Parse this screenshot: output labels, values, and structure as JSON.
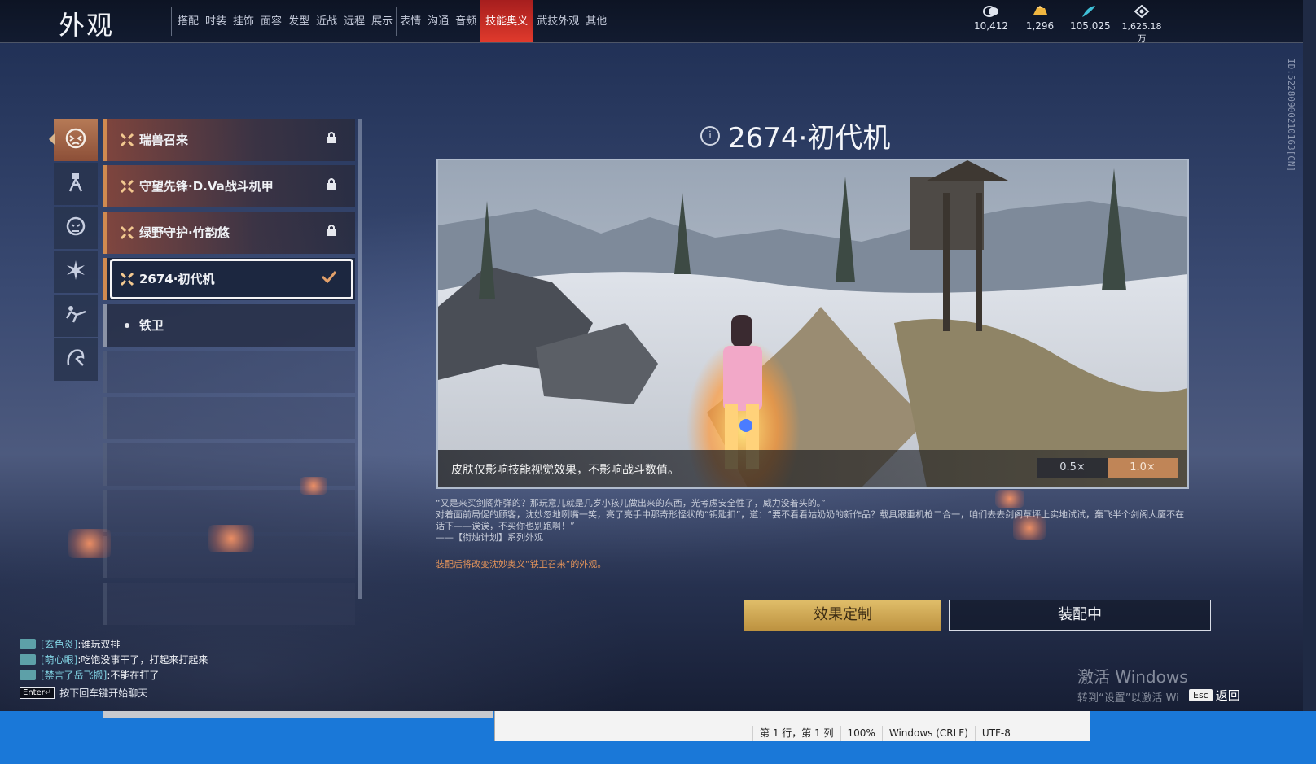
{
  "header": {
    "title": "外观",
    "tabs": [
      {
        "label": "搭配",
        "group": 1
      },
      {
        "label": "时装",
        "group": 1
      },
      {
        "label": "挂饰",
        "group": 1
      },
      {
        "label": "面容",
        "group": 1
      },
      {
        "label": "发型",
        "group": 1
      },
      {
        "label": "近战",
        "group": 1
      },
      {
        "label": "远程",
        "group": 1
      },
      {
        "label": "展示",
        "group": 1
      },
      {
        "label": "表情",
        "group": 2
      },
      {
        "label": "沟通",
        "group": 2
      },
      {
        "label": "音频",
        "group": 2
      },
      {
        "label": "技能奥义",
        "group": 2,
        "active": true
      },
      {
        "label": "武技外观",
        "group": 2
      },
      {
        "label": "其他",
        "group": 2
      }
    ],
    "currencies": [
      {
        "icon": "coin-icon",
        "value": "10,412"
      },
      {
        "icon": "gold-ingot-icon",
        "value": "1,296"
      },
      {
        "icon": "feather-icon",
        "value": "105,025"
      },
      {
        "icon": "diamond-icon",
        "value": "1,625.18万"
      }
    ]
  },
  "side_id": "ID:5228090021016​3[CN]",
  "categories": [
    {
      "icon": "beast-mask-icon",
      "active": true
    },
    {
      "icon": "robot-icon"
    },
    {
      "icon": "lion-mask-icon"
    },
    {
      "icon": "burst-icon"
    },
    {
      "icon": "flying-kick-icon"
    },
    {
      "icon": "dragon-icon"
    }
  ],
  "skins": [
    {
      "name": "瑞兽召来",
      "state": "locked"
    },
    {
      "name": "守望先锋·D.Va战斗机甲",
      "state": "locked"
    },
    {
      "name": "绿野守护·竹韵悠",
      "state": "locked"
    },
    {
      "name": "2674·初代机",
      "state": "equipped",
      "selected": true
    },
    {
      "name": "铁卫",
      "state": "default"
    }
  ],
  "empty_slots": 6,
  "detail": {
    "title": "2674·初代机",
    "caption": "皮肤仅影响技能视觉效果，不影响战斗数值。",
    "speeds": [
      {
        "label": "0.5×",
        "active": false
      },
      {
        "label": "1.0×",
        "active": true
      }
    ],
    "description": [
      "“又是来买剑阁炸弹的？那玩意儿就是几岁小孩儿做出来的东西，光考虑安全性了，威力没着头的。”",
      "对着面前局促的顾客，沈妙忽地咧嘴一笑，亮了亮手中那奇形怪状的“钥匙扣”，道：“要不看看姑奶奶的新作品？载具跟重机枪二合一，咱们去去剑阁草坪上实地试试，轰飞半个剑阁大厦不在话下——诶诶，不买你也别跑啊！”",
      "——【衔烛计划】系列外观"
    ],
    "note": "装配后将改变沈妙奥义“铁卫召来”的外观。"
  },
  "buttons": {
    "customize": "效果定制",
    "equipped": "装配中"
  },
  "chat": {
    "lines": [
      {
        "name": "[玄色炎]",
        "msg": ":谁玩双排"
      },
      {
        "name": "[萌心眼]",
        "msg": ":吃饱没事干了，打起来打起来"
      },
      {
        "name": "[禁言了岳飞搬]",
        "msg": ":不能在打了"
      }
    ],
    "enter_key": "Enter↵",
    "hint": "按下回车键开始聊天"
  },
  "watermark": {
    "title": "激活 Windows",
    "subtitle": "转到“设置”以激活 Wi"
  },
  "back": {
    "key": "Esc",
    "label": "返回"
  },
  "notepad_status": [
    "第 1 行，第 1 列",
    "100%",
    "Windows (CRLF)",
    "UTF-8"
  ],
  "colors": {
    "accent_red": "#e03a2c",
    "accent_orange": "#d08a50",
    "gold_button": "#d8b460"
  }
}
